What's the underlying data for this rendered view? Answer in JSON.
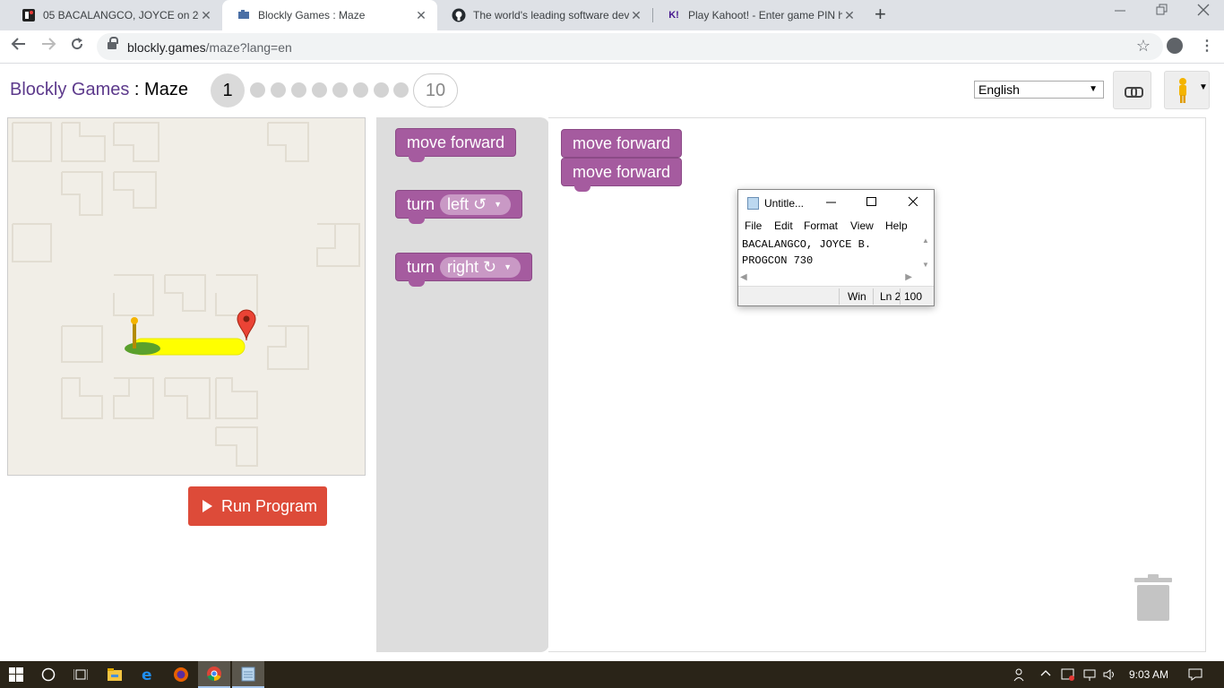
{
  "browser": {
    "tabs": [
      {
        "title": "05 BACALANGCO, JOYCE on 2019",
        "icon": "classroom-icon",
        "close": "✕"
      },
      {
        "title": "Blockly Games : Maze",
        "icon": "blockly-icon",
        "close": "✕"
      },
      {
        "title": "The world's leading software dev",
        "icon": "github-icon",
        "close": "✕"
      },
      {
        "title": "Play Kahoot! - Enter game PIN he",
        "icon": "kahoot-icon",
        "close": "✕",
        "favicon_text": "K!"
      }
    ],
    "new_tab": "+",
    "url_host": "blockly.games",
    "url_path": "/maze?lang=en"
  },
  "game": {
    "brand": "Blockly Games",
    "separator": " : ",
    "name": "Maze",
    "current_level": "1",
    "last_level": "10",
    "language": "English",
    "run_label": "Run Program"
  },
  "toolbox": {
    "move_forward": "move forward",
    "turn_left_prefix": "turn",
    "turn_left_dir": "left ↺",
    "turn_right_prefix": "turn",
    "turn_right_dir": "right ↻"
  },
  "workspace": {
    "blocks": [
      "move forward",
      "move forward"
    ]
  },
  "notepad": {
    "title": "Untitle...",
    "menu": [
      "File",
      "Edit",
      "Format",
      "View",
      "Help"
    ],
    "line1": "BACALANGCO, JOYCE B.",
    "line2": "PROGCON 730",
    "status_eol": "Win",
    "status_pos": "Ln 2",
    "status_zoom": "100"
  },
  "taskbar": {
    "time": "9:03 AM"
  },
  "colors": {
    "brand": "#5d3a8c",
    "block": "#a55b9f",
    "run_button": "#dd4b39",
    "maze_bg": "#f1eee7",
    "path": "#ffff00"
  }
}
